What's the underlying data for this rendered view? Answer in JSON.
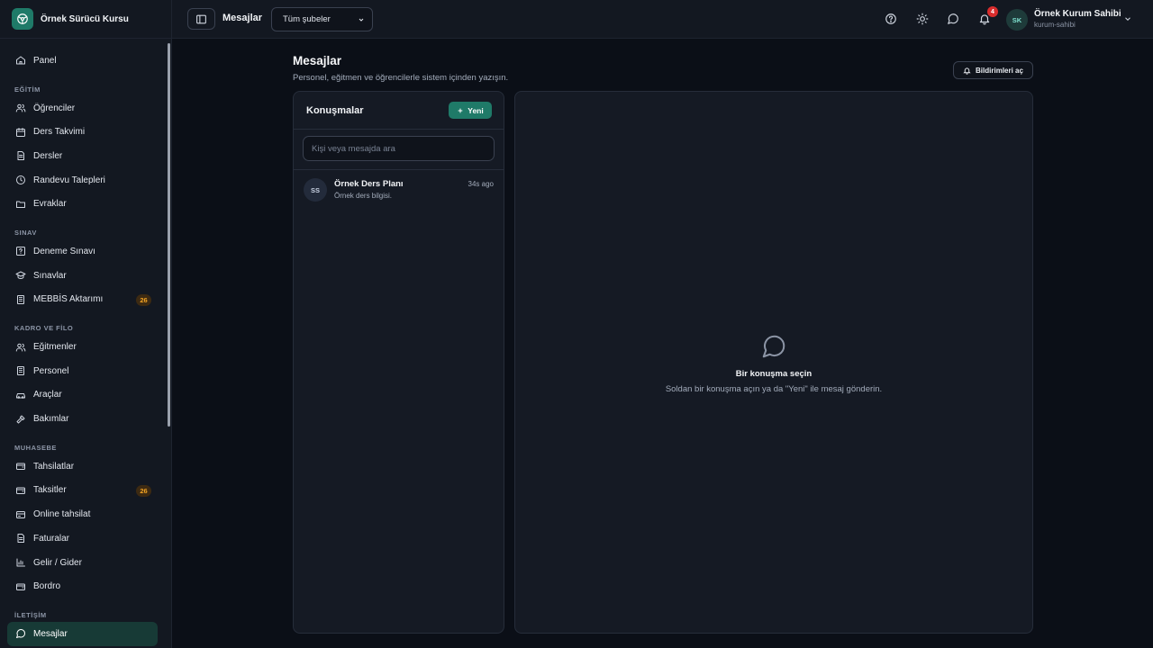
{
  "brand": {
    "name": "Örnek Sürücü Kursu"
  },
  "sidebar": {
    "top_item": {
      "label": "Panel",
      "icon": "home-icon"
    },
    "sections": [
      {
        "title": "EĞİTİM",
        "items": [
          {
            "label": "Öğrenciler",
            "icon": "users-icon"
          },
          {
            "label": "Ders Takvimi",
            "icon": "calendar-icon"
          },
          {
            "label": "Dersler",
            "icon": "document-icon"
          },
          {
            "label": "Randevu Talepleri",
            "icon": "clock-icon"
          },
          {
            "label": "Evraklar",
            "icon": "folder-icon"
          }
        ]
      },
      {
        "title": "SINAV",
        "items": [
          {
            "label": "Deneme Sınavı",
            "icon": "question-icon"
          },
          {
            "label": "Sınavlar",
            "icon": "graduation-cap-icon"
          },
          {
            "label": "MEBBİS Aktarımı",
            "icon": "building-icon",
            "badge": "26"
          }
        ]
      },
      {
        "title": "KADRO VE FİLO",
        "items": [
          {
            "label": "Eğitmenler",
            "icon": "users-icon"
          },
          {
            "label": "Personel",
            "icon": "building-icon"
          },
          {
            "label": "Araçlar",
            "icon": "car-icon"
          },
          {
            "label": "Bakımlar",
            "icon": "hammer-icon"
          }
        ]
      },
      {
        "title": "MUHASEBE",
        "items": [
          {
            "label": "Tahsilatlar",
            "icon": "wallet-icon"
          },
          {
            "label": "Taksitler",
            "icon": "wallet-icon",
            "badge": "26"
          },
          {
            "label": "Online tahsilat",
            "icon": "credit-card-icon"
          },
          {
            "label": "Faturalar",
            "icon": "document-icon"
          },
          {
            "label": "Gelir / Gider",
            "icon": "bar-chart-icon"
          },
          {
            "label": "Bordro",
            "icon": "wallet-icon"
          }
        ]
      },
      {
        "title": "İLETİŞİM",
        "items": [
          {
            "label": "Mesajlar",
            "icon": "message-icon",
            "active": true
          }
        ]
      }
    ]
  },
  "header": {
    "title": "Mesajlar",
    "branch_select": {
      "value": "Tüm şubeler",
      "options": [
        "Tüm şubeler"
      ]
    },
    "notification_count": "4",
    "user": {
      "initials": "SK",
      "name": "Örnek Kurum Sahibi",
      "role": "kurum-sahibi"
    }
  },
  "page": {
    "title": "Mesajlar",
    "subtitle": "Personel, eğitmen ve öğrencilerle sistem içinden yazışın.",
    "notif_button": "Bildirimleri aç"
  },
  "conversations": {
    "title": "Konuşmalar",
    "new_button": "Yeni",
    "search_placeholder": "Kişi veya mesajda ara",
    "items": [
      {
        "initials": "SS",
        "name": "Örnek Ders Planı",
        "preview": "Örnek ders bilgisi.",
        "time": "34s ago"
      }
    ]
  },
  "chat": {
    "empty_title": "Bir konuşma seçin",
    "empty_text": "Soldan bir konuşma açın ya da \"Yeni\" ile mesaj gönderin."
  },
  "colors": {
    "accent": "#1f7a68",
    "background": "#0b0f17",
    "panel": "#151a24",
    "badge": "#f5a524",
    "danger": "#d92d2d"
  }
}
